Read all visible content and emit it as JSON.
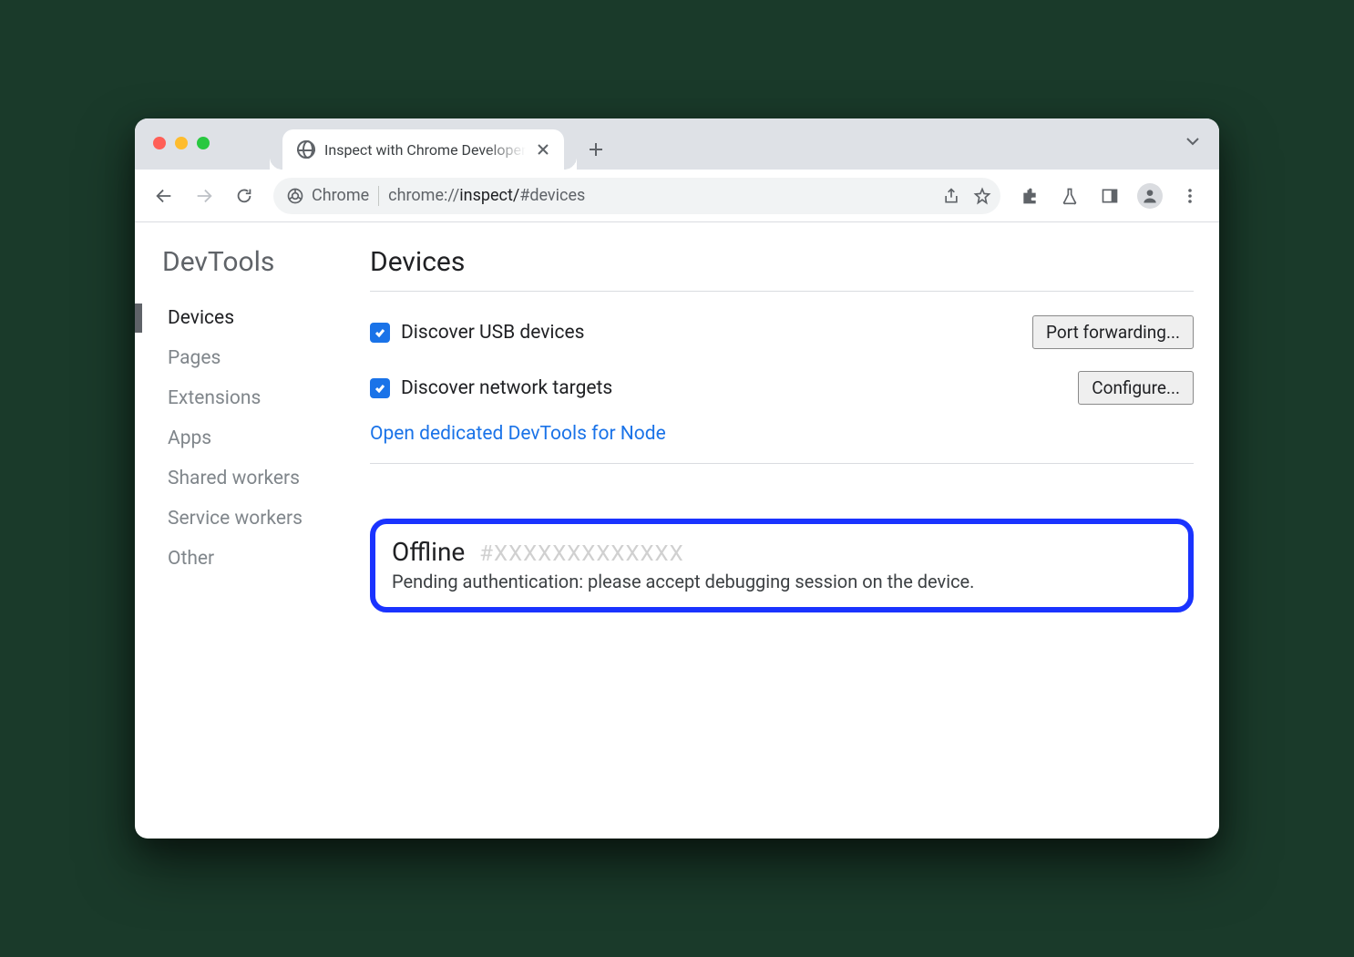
{
  "tab": {
    "title": "Inspect with Chrome Developer"
  },
  "omnibox": {
    "chip_label": "Chrome",
    "url_prefix": "chrome://",
    "url_path": "inspect/",
    "url_hash": "#devices"
  },
  "sidebar": {
    "title": "DevTools",
    "items": [
      "Devices",
      "Pages",
      "Extensions",
      "Apps",
      "Shared workers",
      "Service workers",
      "Other"
    ],
    "active_index": 0
  },
  "main": {
    "heading": "Devices",
    "checkbox_usb": "Discover USB devices",
    "button_port": "Port forwarding...",
    "checkbox_network": "Discover network targets",
    "button_configure": "Configure...",
    "link_node": "Open dedicated DevTools for Node",
    "device": {
      "status": "Offline",
      "id": "#XXXXXXXXXXXXX",
      "message": "Pending authentication: please accept debugging session on the device."
    }
  }
}
